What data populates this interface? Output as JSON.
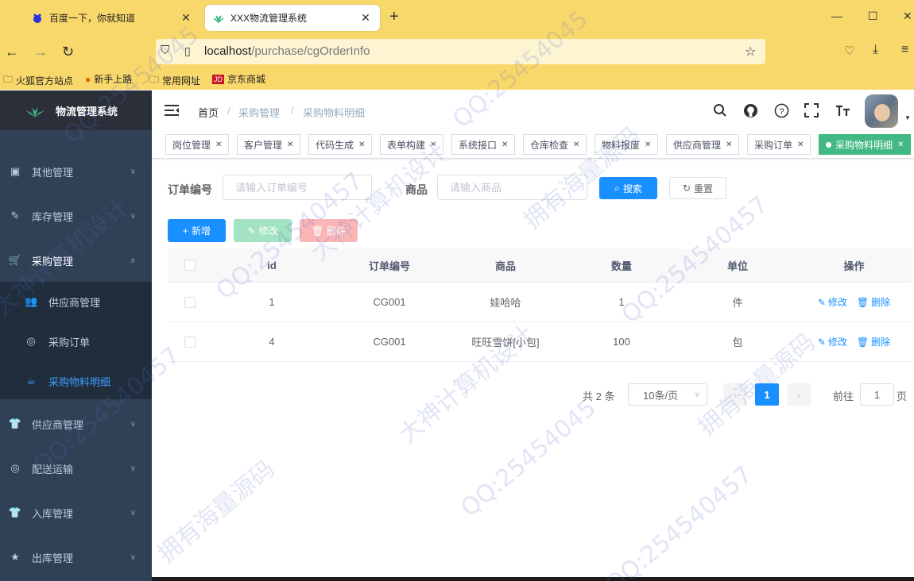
{
  "browser": {
    "tabs": [
      {
        "title": "百度一下，你就知道",
        "active": false
      },
      {
        "title": "XXX物流管理系统",
        "active": true
      }
    ],
    "url_host": "localhost",
    "url_path": "/purchase/cgOrderInfo",
    "bookmarks": [
      "火狐官方站点",
      "新手上路",
      "常用网址",
      "京东商城"
    ]
  },
  "sidebar": {
    "logo": "物流管理系统",
    "items": [
      {
        "label": "其他管理",
        "icon": "briefcase-icon"
      },
      {
        "label": "库存管理",
        "icon": "edit-icon"
      },
      {
        "label": "采购管理",
        "icon": "cart-icon",
        "expanded": true
      },
      {
        "label": "供应商管理",
        "icon": "shirt-icon"
      },
      {
        "label": "配送运输",
        "icon": "lifebuoy-icon"
      },
      {
        "label": "入库管理",
        "icon": "shirt-icon"
      },
      {
        "label": "出库管理",
        "icon": "star-icon"
      }
    ],
    "sub_items": [
      {
        "label": "供应商管理",
        "icon": "people-icon"
      },
      {
        "label": "采购订单",
        "icon": "lifebuoy-icon"
      },
      {
        "label": "采购物料明细",
        "icon": "cup-icon",
        "active": true
      }
    ]
  },
  "header": {
    "breadcrumb": [
      "首页",
      "采购管理",
      "采购物料明细"
    ]
  },
  "tags": [
    "岗位管理",
    "客户管理",
    "代码生成",
    "表单构建",
    "系统接口",
    "仓库检查",
    "物料报废",
    "供应商管理",
    "采购订单",
    "采购物料明细"
  ],
  "search": {
    "order_label": "订单编号",
    "order_placeholder": "请输入订单编号",
    "goods_label": "商品",
    "goods_placeholder": "请输入商品",
    "search_btn": "搜索",
    "reset_btn": "重置"
  },
  "toolbar": {
    "add": "新增",
    "edit": "修改",
    "delete": "删除"
  },
  "table": {
    "columns": [
      "id",
      "订单编号",
      "商品",
      "数量",
      "单位",
      "操作"
    ],
    "rows": [
      {
        "id": "1",
        "order_no": "CG001",
        "goods": "娃哈哈",
        "qty": "1",
        "unit": "件"
      },
      {
        "id": "4",
        "order_no": "CG001",
        "goods": "旺旺雪饼[小包]",
        "qty": "100",
        "unit": "包"
      }
    ],
    "op_edit": "修改",
    "op_delete": "删除"
  },
  "pagination": {
    "total_text": "共 2 条",
    "page_size": "10条/页",
    "current_page": "1",
    "goto_label": "前往",
    "goto_value": "1",
    "page_suffix": "页"
  },
  "watermarks": [
    "QQ:25454045",
    "大神计算机设计",
    "拥有海量源码",
    "QQ:254540457"
  ]
}
